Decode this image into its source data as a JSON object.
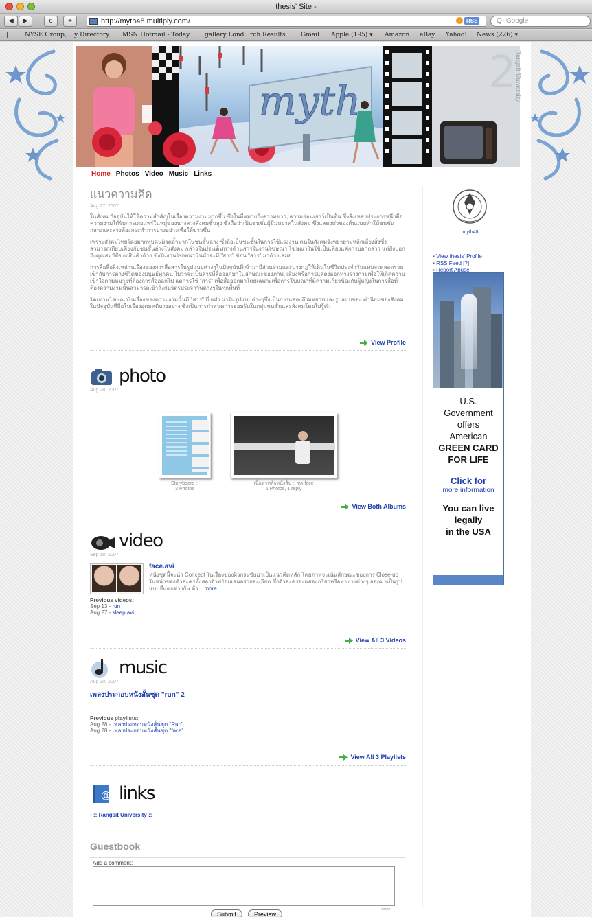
{
  "browser": {
    "window_title": "thesis' Site -",
    "url": "http://myth48.multiply.com/",
    "rss_label": "RSS",
    "search_placeholder": "Q- Google",
    "bookmarks": [
      "NYSE Group, ...y Directory",
      "MSN Hotmail - Today",
      "gallery Lond...rch Results",
      "Gmail",
      "Apple (195) ▾",
      "Amazon",
      "eBay",
      "Yahoo!",
      "News (226) ▾"
    ]
  },
  "banner": {
    "logo_text": "myth",
    "side_text": "Rangsit University"
  },
  "nav": [
    "Home",
    "Photos",
    "Video",
    "Music",
    "Links"
  ],
  "article": {
    "title": "แนวความคิด",
    "date": "Aug 27, 2007",
    "paragraphs": [
      "ในสังคมปัจจุบันให้ให้ความสำคัญในเรื่องความงามมากขึ้น ซึ่งในที่หมายถึงความขาว, ความอ่อนเยาว์เป็นต้น ซึ่งสิ่งเหล่าประการหนึ่งคือความงามได้รับการเผยแพร่ในหมู่ของนางสวงสังคมชั้นสูง ซึ่งถือว่าเป็นชนชั้นผู้มีมหยาทในสังคม ซึ่งแสดงทั่วของต้นแบบทำให้ชนชั้นกลางและล่างต้องกระทำการบางอย่างเพื่อให้ขาวขึ้น",
      "เพราะสังคมไทยโดยมากพบคนผิวคล้ำมากในชนชั้นล่าง ซึ่งถือเป็นชนชั้นในการใช้แรงงาน คนในสังคมจึงพยายามหลีกเลี่ยงสิ่งซึ่งสามารถเทียบเคียงกับชนชั้นล่างในสังคม กล่าวในประเด็นทางด้านสารในงานโฆษณา โฆษณาในใช้เป็นเพียงแค่การบอกกล่าว แต่ยังบอกถึงคุณสมบัติของสินค้าด้วย ซึ่งในงานโฆษณาน้นมักจะมี \"สาร\" ช้อน \"สาร\" มาด้วยเสมอ",
      "การสื่อสื่อสิ่งเหล่านเรื่องของการสื่อสารในรูปแบบต่างๆในปัจจุบันที่เข้ามามีส่วนร่วมและบางกฎให้เห็นในชีวิตประจำวันแทบจะตลอดรวมเข้ากับการต่างชีวิตของมนุษย์ทุกคน ไม่ว่าจะเป็นสารที่สื่อออกมาในลักษณะของภาพ, เสียงหรือการแสดงออกทางร่างกายเพื่อให้เกิดความเข้าใจตามหมายที่ต้องการสื่อออกไป แต่การใช้ \"สาร\" เพื่อสื่อออกมาโดยเฉพาะเพื่อการโฆษณาที่มีความเกี่ยวข้องกับผู้หญิงในการสื่อที่ต้องความงามนั้นสามารถเข้าถึงกับวิตรประจำวันต่างๆในทุกพื้นที่",
      "โดยงานโฆษณาในเรื่องของความงามนั้นมี \"สาร\" ที่ แฝง มาในรูปแบบต่างๆซึ่งเป็นการแสดงถึงมหยาทและรูปแบบของ ค่านิยมของสังคมในปัจจุบันที่ถือในเรื่องอุดมคติบางอย่าง ซึ่งเป็นการกำหนดการยอมรับในกลุ่มชนชั้นและสังคมโดยไม่รู้ตัว"
    ],
    "more_link": "View Profile"
  },
  "photo": {
    "heading": "photo",
    "date": "Aug 28, 2007",
    "albums": [
      {
        "title": "Storyboard ::",
        "sub": "3 Photos"
      },
      {
        "title": "เนื้อหาหลักหนังสั้น :: ชุด face",
        "sub": "6 Photos, 1 reply"
      }
    ],
    "more_link": "View Both Albums"
  },
  "video": {
    "heading": "video",
    "date": "Sep 18, 2007",
    "title": "face.avi",
    "desc": "หนังชุดนี้จะนำ Concept ในเรื่องของผิวกระชับมาเป็นแนวคิดหลัก โดยภาพจะเน้นลักษณะของการ Close-up ในหน้าของตัวละครทั้งสองตัวพร้อมเสนอรายละเอียด ซึ่งตัวละครจะแสดงกริยาหรือท่าทางต่างๆ ออกมาเป็นรูปแบบที่แตกต่างกัน ตัว...",
    "more_inline": "more",
    "prev_label": "Previous videos:",
    "prev": [
      {
        "date": "Sep 13 - ",
        "link": "run"
      },
      {
        "date": "Aug 27 - ",
        "link": "sleep.avi"
      }
    ],
    "more_link": "View All 3 Videos"
  },
  "music": {
    "heading": "music",
    "date": "Aug 30, 2007",
    "title": "เพลงประกอบหนังสั้นชุด \"run\" 2",
    "prev_label": "Previous playlists:",
    "prev": [
      {
        "date": "Aug 28 - ",
        "link": "เพลงประกอบหนังสั้นชุด \"Run\""
      },
      {
        "date": "Aug 28 - ",
        "link": "เพลงประกอบหนังสั้นชุด \"face\""
      }
    ],
    "more_link": "View All 3 Playlists"
  },
  "links": {
    "heading": "links",
    "items": [
      ":: Rangsit University ::"
    ]
  },
  "guestbook": {
    "heading": "Guestbook",
    "label": "Add a comment:",
    "submit": "Submit",
    "preview": "Preview",
    "stars": "*****"
  },
  "sidebar": {
    "username": "myth48",
    "links": [
      "View thesis' Profile",
      "RSS Feed [?]",
      "Report Abuse"
    ],
    "ad": {
      "line1": "U.S.",
      "line2": "Government",
      "line3": "offers",
      "line4": "American",
      "line5": "GREEN CARD",
      "line6": "FOR LIFE",
      "click": "Click for",
      "more": "more information",
      "tag1": "You can live",
      "tag2": "legally",
      "tag3": "in the USA"
    }
  },
  "colors": {
    "accent": "#1f3fb0",
    "active_nav": "#d22222"
  }
}
